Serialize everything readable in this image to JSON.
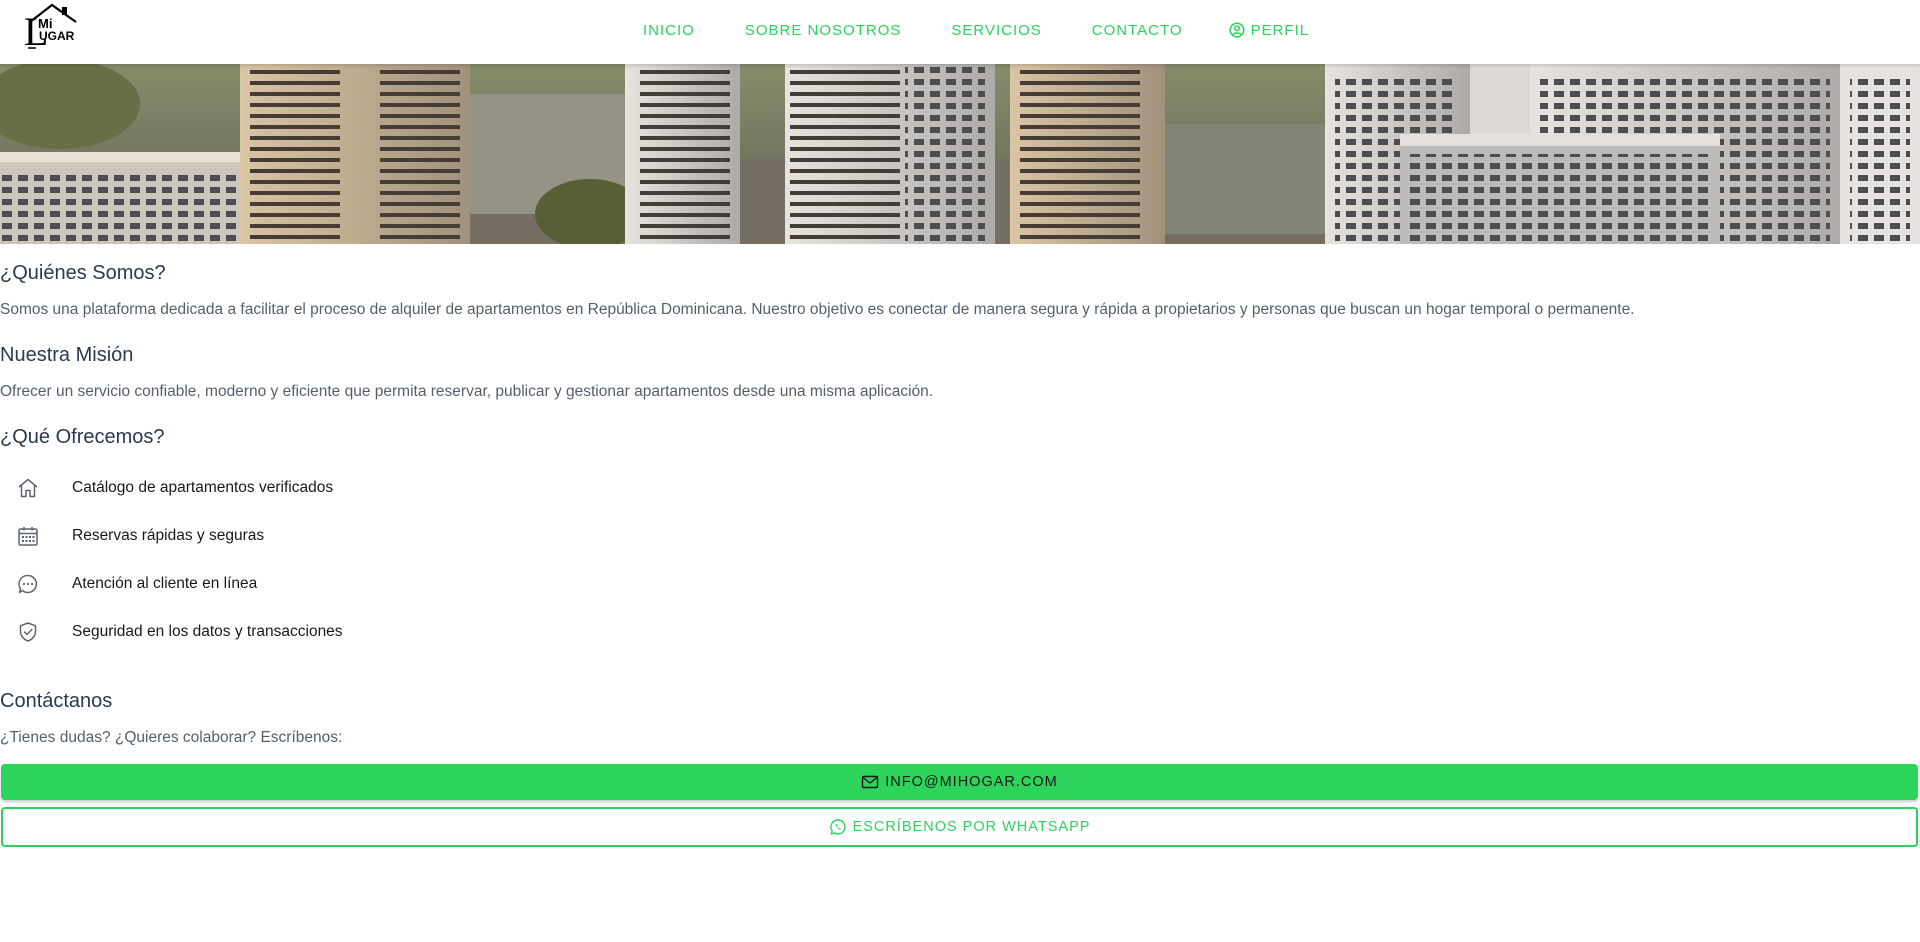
{
  "brand": {
    "logo_mi": "Mi",
    "logo_l": "L",
    "logo_ugar": "UGAR"
  },
  "nav": {
    "items": [
      {
        "label": "INICIO"
      },
      {
        "label": "SOBRE NOSOTROS"
      },
      {
        "label": "SERVICIOS"
      },
      {
        "label": "CONTACTO"
      },
      {
        "label": "PERFIL",
        "icon": "user-circle-icon"
      }
    ]
  },
  "about": {
    "title": "¿Quiénes Somos?",
    "text": "Somos una plataforma dedicada a facilitar el proceso de alquiler de apartamentos en República Dominicana. Nuestro objetivo es conectar de manera segura y rápida a propietarios y personas que buscan un hogar temporal o permanente."
  },
  "mission": {
    "title": "Nuestra Misión",
    "text": "Ofrecer un servicio confiable, moderno y eficiente que permita reservar, publicar y gestionar apartamentos desde una misma aplicación."
  },
  "offer": {
    "title": "¿Qué Ofrecemos?",
    "items": [
      {
        "label": "Catálogo de apartamentos verificados",
        "icon": "home-icon"
      },
      {
        "label": "Reservas rápidas y seguras",
        "icon": "calendar-icon"
      },
      {
        "label": "Atención al cliente en línea",
        "icon": "chat-icon"
      },
      {
        "label": "Seguridad en los datos y transacciones",
        "icon": "shield-check-icon"
      }
    ]
  },
  "contact": {
    "title": "Contáctanos",
    "text": "¿Tienes dudas? ¿Quieres colaborar? Escríbenos:",
    "email_button": "INFO@MIHOGAR.COM",
    "whatsapp_button": "ESCRÍBENOS POR WHATSAPP"
  },
  "colors": {
    "accent": "#2ed35c",
    "heading": "#2b3a50",
    "body_text": "#555f6c"
  }
}
